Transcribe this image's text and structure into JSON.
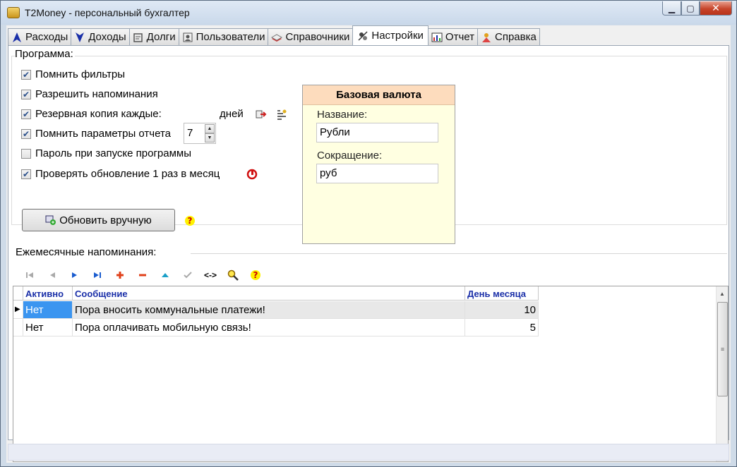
{
  "window": {
    "title": "T2Money - персональный бухгалтер",
    "min_label": "▁",
    "max_label": "▢",
    "close_label": "✕"
  },
  "tabs": [
    {
      "label": "Расходы",
      "icon": "arrow-up-icon",
      "color": "#1a2fa8"
    },
    {
      "label": "Доходы",
      "icon": "arrow-down-icon",
      "color": "#1a2fa8"
    },
    {
      "label": "Долги",
      "icon": "debts-icon",
      "color": "#555555"
    },
    {
      "label": "Пользователи",
      "icon": "users-icon",
      "color": "#555555"
    },
    {
      "label": "Справочники",
      "icon": "books-icon",
      "color": "#b33"
    },
    {
      "label": "Настройки",
      "icon": "settings-icon",
      "color": "#555555",
      "active": true
    },
    {
      "label": "Отчет",
      "icon": "report-icon",
      "color": "#b33"
    },
    {
      "label": "Справка",
      "icon": "help-icon",
      "color": "#d29a12"
    }
  ],
  "program": {
    "title": "Программа:",
    "options": [
      {
        "label": "Помнить фильтры",
        "checked": true
      },
      {
        "label": "Разрешить напоминания",
        "checked": true
      },
      {
        "label": "Резервная копия каждые:",
        "checked": true
      },
      {
        "label": "Помнить параметры отчета",
        "checked": true
      },
      {
        "label": "Пароль при запуске программы",
        "checked": false
      },
      {
        "label": "Проверять обновление 1 раз в месяц",
        "checked": true
      }
    ],
    "backup_days_value": "7",
    "backup_days_unit": "дней",
    "update_button": "Обновить вручную"
  },
  "currency": {
    "title": "Базовая валюта",
    "name_label": "Название:",
    "name_value": "Рубли",
    "abbr_label": "Сокращение:",
    "abbr_value": "руб"
  },
  "reminders": {
    "title": "Ежемесячные напоминания:",
    "toolbar": [
      "first-icon",
      "prev-icon",
      "next-icon",
      "last-icon",
      "add-icon",
      "delete-icon",
      "up-icon",
      "check-icon",
      "swap-icon",
      "search-icon",
      "help-icon"
    ],
    "swap_label": "<->",
    "columns": [
      "Активно",
      "Сообщение",
      "День месяца"
    ],
    "rows": [
      {
        "active": "Нет",
        "message": "Пора вносить коммунальные платежи!",
        "day": "10"
      },
      {
        "active": "Нет",
        "message": "Пора оплачивать мобильную связь!",
        "day": "5"
      }
    ]
  }
}
